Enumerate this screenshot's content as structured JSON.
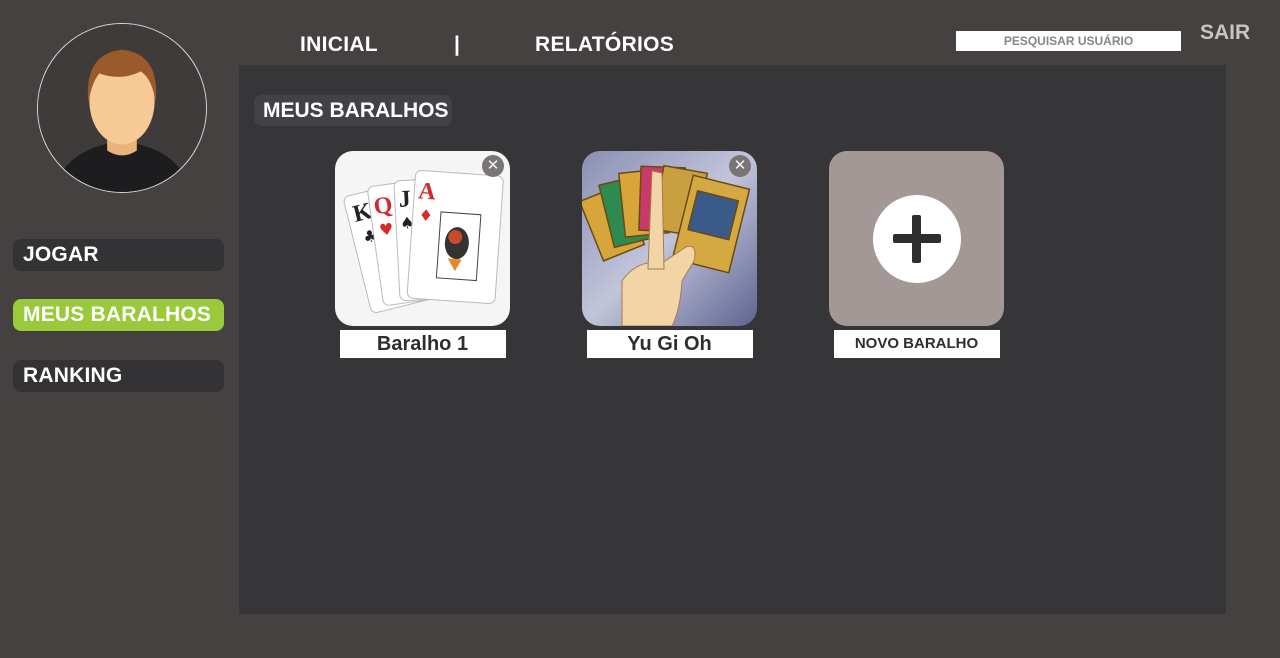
{
  "topnav": {
    "home_label": "INICIAL",
    "separator": "|",
    "reports_label": "RELATÓRIOS",
    "search_placeholder": "PESQUISAR USUÁRIO",
    "logout_label": "SAIR"
  },
  "sidebar": {
    "items": [
      {
        "label": "JOGAR",
        "active": false
      },
      {
        "label": "MEUS BARALHOS",
        "active": true
      },
      {
        "label": "RANKING",
        "active": false
      }
    ]
  },
  "main": {
    "section_title": "MEUS BARALHOS",
    "decks": [
      {
        "name": "Baralho 1",
        "icon": "playing-cards-image",
        "removable": true
      },
      {
        "name": "Yu Gi Oh",
        "icon": "yugioh-cards-image",
        "removable": true
      }
    ],
    "new_deck_label": "NOVO BARALHO",
    "close_symbol": "✕"
  },
  "colors": {
    "background": "#464141",
    "panel": "#363538",
    "active_accent": "#9ac93c",
    "new_deck_tile": "#a39896"
  }
}
